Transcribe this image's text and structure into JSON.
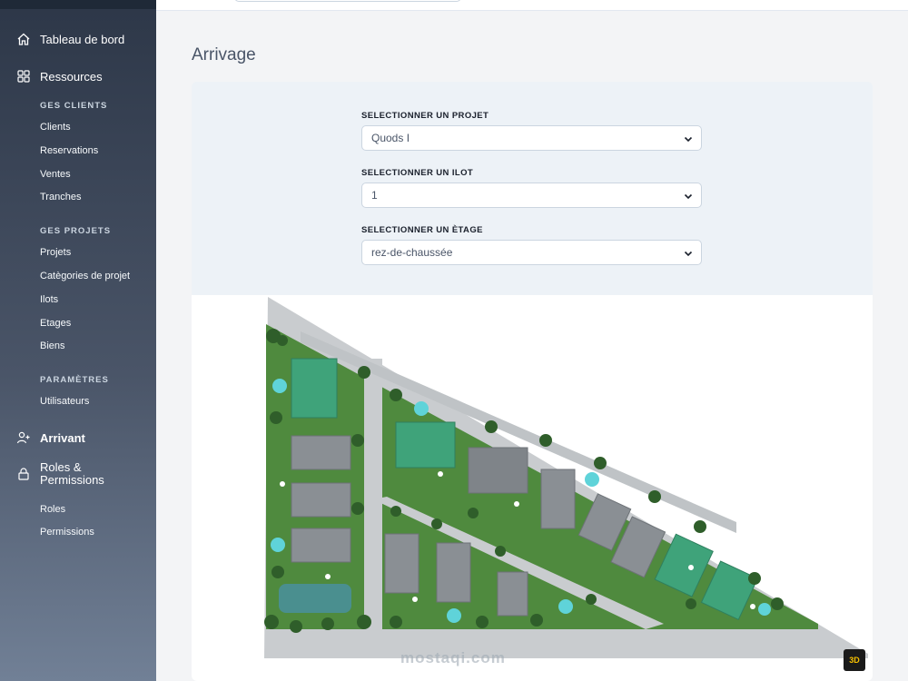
{
  "sidebar": {
    "main": [
      {
        "label": "Tableau de bord",
        "icon": "home-icon"
      },
      {
        "label": "Ressources",
        "icon": "grid-icon"
      },
      {
        "label": "Arrivant",
        "icon": "user-plus-icon"
      },
      {
        "label": "Roles &",
        "label2": "Permissions",
        "icon": "lock-icon"
      }
    ],
    "sections": {
      "clients": "GES CLIENTS",
      "projets": "GES PROJETS",
      "parametres": "PARAMÈTRES"
    },
    "clients_items": [
      "Clients",
      "Reservations",
      "Ventes",
      "Tranches"
    ],
    "projets_items": [
      "Projets",
      "Catègories de projet",
      "Ilots",
      "Etages",
      "Biens"
    ],
    "parametres_items": [
      "Utilisateurs"
    ],
    "roles_items": [
      "Roles",
      "Permissions"
    ]
  },
  "page": {
    "title": "Arrivage"
  },
  "form": {
    "projet_label": "SELECTIONNER UN PROJET",
    "projet_value": "Quods I",
    "ilot_label": "SELECTIONNER UN ILOT",
    "ilot_value": "1",
    "etage_label": "SELECTIONNER UN ÈTAGE",
    "etage_value": "rez-de-chaussée"
  },
  "plan": {
    "watermark": "mostaqi.com",
    "logo_text": "3D"
  },
  "colors": {
    "grass": "#4f8a3e",
    "road": "#c9cccf",
    "roof_gray": "#8a8f94",
    "roof_green": "#3fa37a",
    "pool": "#5fd3d9"
  }
}
